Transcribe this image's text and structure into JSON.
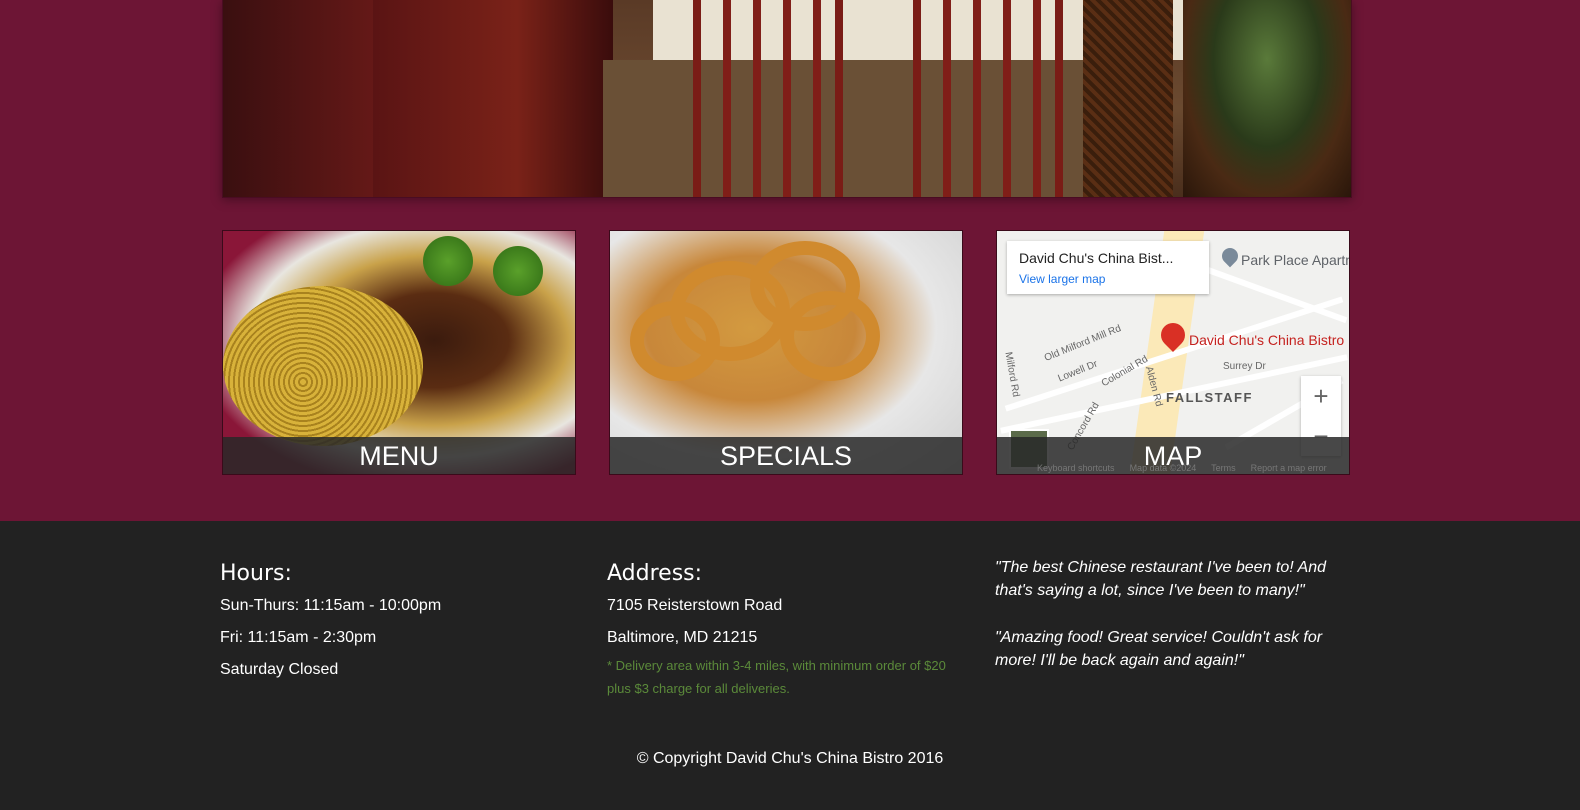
{
  "cards": {
    "menu_label": "MENU",
    "specials_label": "SPECIALS",
    "map_label": "MAP"
  },
  "map": {
    "place_title": "David Chu's China Bist...",
    "view_larger": "View larger map",
    "pin_label": "David Chu's China Bistro",
    "poi_label": "Park Place Apartm",
    "district": "FALLSTAFF",
    "streets": [
      "Old Milford Mill Rd",
      "Lowell Dr",
      "Colonial Rd",
      "Alden Rd",
      "Surrey Dr",
      "Concord Rd",
      "Milford Rd"
    ],
    "zoom_in": "+",
    "zoom_out": "−",
    "footer_links": [
      "Keyboard shortcuts",
      "Map data ©2024",
      "Terms",
      "Report a map error"
    ]
  },
  "footer": {
    "hours_title": "Hours:",
    "hours": [
      "Sun-Thurs: 11:15am - 10:00pm",
      "Fri: 11:15am - 2:30pm",
      "Saturday Closed"
    ],
    "address_title": "Address:",
    "address": [
      "7105 Reisterstown Road",
      "Baltimore, MD 21215"
    ],
    "delivery_note": "* Delivery area within 3-4 miles, with minimum order of $20 plus $3 charge for all deliveries.",
    "quotes": [
      "\"The best Chinese restaurant I've been to! And that's saying a lot, since I've been to many!\"",
      "\"Amazing food! Great service! Couldn't ask for more! I'll be back again and again!\""
    ],
    "copyright": "© Copyright David Chu's China Bistro 2016"
  },
  "colors": {
    "page_bg": "#6d1535",
    "footer_bg": "#222222",
    "note_green": "#5b8a3a",
    "map_pin": "#d93025",
    "map_link": "#1a73e8"
  }
}
